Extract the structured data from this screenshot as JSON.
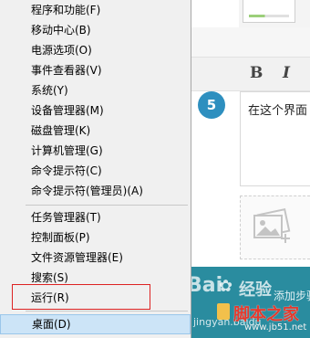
{
  "menu": {
    "items": [
      {
        "label": "程序和功能(F)"
      },
      {
        "label": "移动中心(B)"
      },
      {
        "label": "电源选项(O)"
      },
      {
        "label": "事件查看器(V)"
      },
      {
        "label": "系统(Y)"
      },
      {
        "label": "设备管理器(M)"
      },
      {
        "label": "磁盘管理(K)"
      },
      {
        "label": "计算机管理(G)"
      },
      {
        "label": "命令提示符(C)"
      },
      {
        "label": "命令提示符(管理员)(A)"
      },
      {
        "label": "任务管理器(T)"
      },
      {
        "label": "控制面板(P)"
      },
      {
        "label": "文件资源管理器(E)"
      },
      {
        "label": "搜索(S)"
      },
      {
        "label": "运行(R)"
      },
      {
        "label": "桌面(D)"
      }
    ],
    "highlighted": "桌面(D)",
    "annotated": "运行(R)"
  },
  "editor": {
    "bold_label": "B",
    "italic_label": "I",
    "step_number": "5",
    "step_text": "在这个界面",
    "bottom_text": "添加步骤"
  },
  "watermarks": {
    "baidu": "Bai",
    "baidu_suffix": "经验",
    "jingyan_url": "jingyan.baidu",
    "jb51_name": "脚本之家",
    "jb51_url": "www.jb51.net"
  },
  "colors": {
    "highlight": "#cce4f7",
    "annotation_red": "#dd2222",
    "step_circle": "#2e8fbf",
    "banner": "#2a8c9f"
  }
}
